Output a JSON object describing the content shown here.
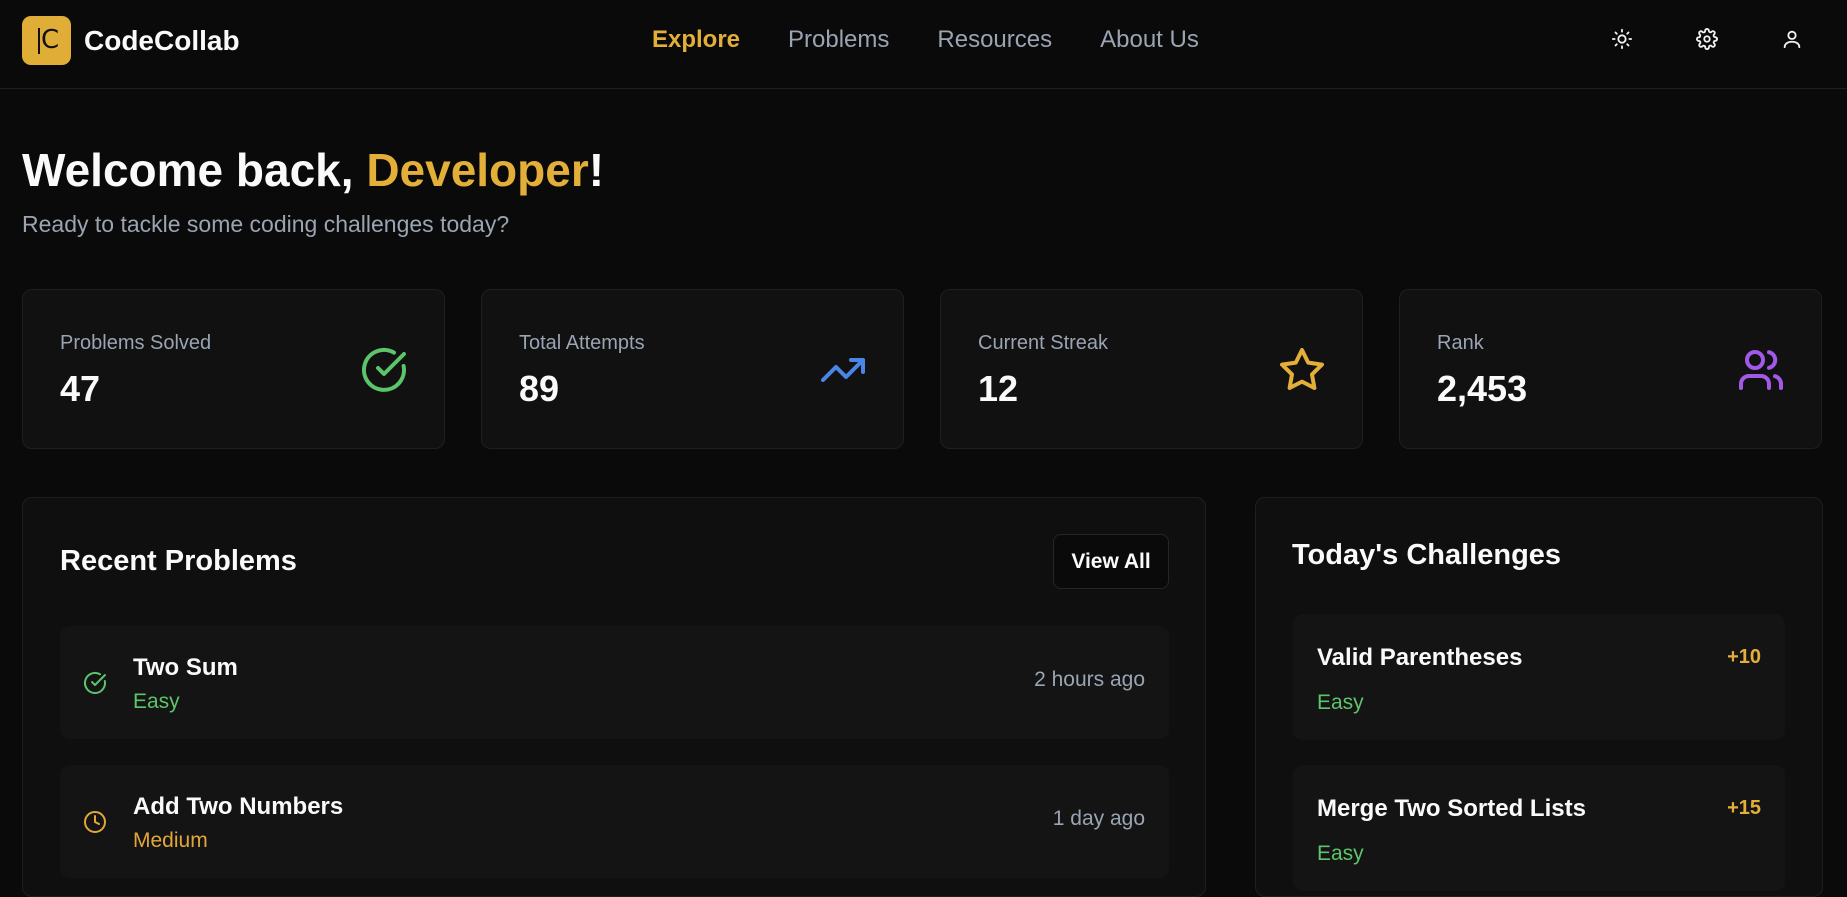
{
  "app": {
    "brand_letter": "C",
    "brand_name": "CodeCollab"
  },
  "nav": {
    "items": [
      {
        "label": "Explore",
        "active": true
      },
      {
        "label": "Problems",
        "active": false
      },
      {
        "label": "Resources",
        "active": false
      },
      {
        "label": "About Us",
        "active": false
      }
    ]
  },
  "header_icons": [
    "sun-icon",
    "gear-icon",
    "user-icon"
  ],
  "welcome": {
    "prefix": "Welcome back, ",
    "name": "Developer",
    "suffix": "!",
    "subtitle": "Ready to tackle some coding challenges today?"
  },
  "stats": [
    {
      "label": "Problems Solved",
      "value": "47",
      "icon": "check-circle-icon",
      "color": "#5cc46a"
    },
    {
      "label": "Total Attempts",
      "value": "89",
      "icon": "trending-up-icon",
      "color": "#4a86e8"
    },
    {
      "label": "Current Streak",
      "value": "12",
      "icon": "star-icon",
      "color": "#e3af38"
    },
    {
      "label": "Rank",
      "value": "2,453",
      "icon": "users-icon",
      "color": "#a259e8"
    }
  ],
  "recent": {
    "title": "Recent Problems",
    "view_all": "View All",
    "items": [
      {
        "name": "Two Sum",
        "difficulty": "Easy",
        "time": "2 hours ago",
        "icon": "check-circle-icon",
        "color": "#5cc46a"
      },
      {
        "name": "Add Two Numbers",
        "difficulty": "Medium",
        "time": "1 day ago",
        "icon": "clock-icon",
        "color": "#e3a738"
      }
    ]
  },
  "challenges": {
    "title": "Today's Challenges",
    "items": [
      {
        "name": "Valid Parentheses",
        "points": "+10",
        "difficulty": "Easy",
        "color": "#5cc46a"
      },
      {
        "name": "Merge Two Sorted Lists",
        "points": "+15",
        "difficulty": "Easy",
        "color": "#5cc46a"
      }
    ]
  },
  "colors": {
    "accent": "#e3af38",
    "background": "#0a0a0a",
    "card": "#111111",
    "muted_text": "#9aa4b2"
  }
}
